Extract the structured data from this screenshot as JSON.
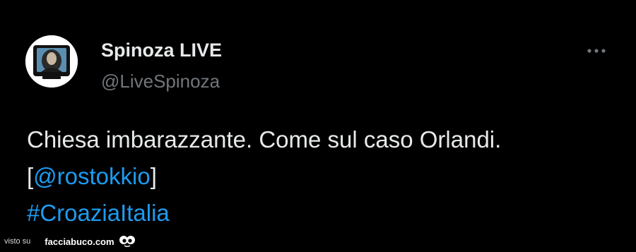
{
  "tweet": {
    "author": {
      "display_name": "Spinoza LIVE",
      "handle": "@LiveSpinoza",
      "avatar_icon": "portrait-tv-avatar"
    },
    "more_icon": "more-horizontal-icon",
    "text": {
      "line1": "Chiesa imbarazzante. Come sul caso Orlandi.",
      "bracket_open": "[",
      "mention": "@rostokkio",
      "bracket_close": "]",
      "hashtag": "#CroaziaItalia"
    }
  },
  "watermark": {
    "prefix": "visto su",
    "site": "facciabuco.com",
    "icon": "eyes-face-icon"
  },
  "colors": {
    "background": "#000000",
    "text": "#e7e9ea",
    "secondary_text": "#71767b",
    "link": "#1d9bf0"
  }
}
